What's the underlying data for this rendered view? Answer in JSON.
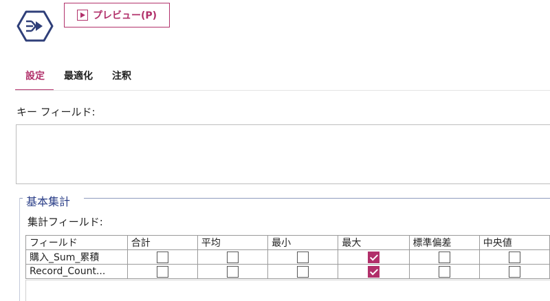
{
  "toolbar": {
    "node_icon": "summarize-node-icon",
    "preview_label": "プレビュー(P)",
    "preview_icon": "play-icon"
  },
  "tabs": [
    {
      "label": "設定",
      "active": true
    },
    {
      "label": "最適化",
      "active": false
    },
    {
      "label": "注釈",
      "active": false
    }
  ],
  "settings": {
    "key_fields_label": "キー フィールド:",
    "key_fields_value": ""
  },
  "basic_aggregation": {
    "group_title": "基本集計",
    "fields_label": "集計フィールド:",
    "columns": [
      "フィールド",
      "合計",
      "平均",
      "最小",
      "最大",
      "標準偏差",
      "中央値"
    ],
    "rows": [
      {
        "field": "購入_Sum_累積",
        "checks": [
          false,
          false,
          false,
          true,
          false,
          false
        ]
      },
      {
        "field": "Record_Count...",
        "checks": [
          false,
          false,
          false,
          true,
          false,
          false
        ]
      }
    ]
  },
  "colors": {
    "accent": "#b1306a",
    "group_title": "#2b3f88"
  }
}
